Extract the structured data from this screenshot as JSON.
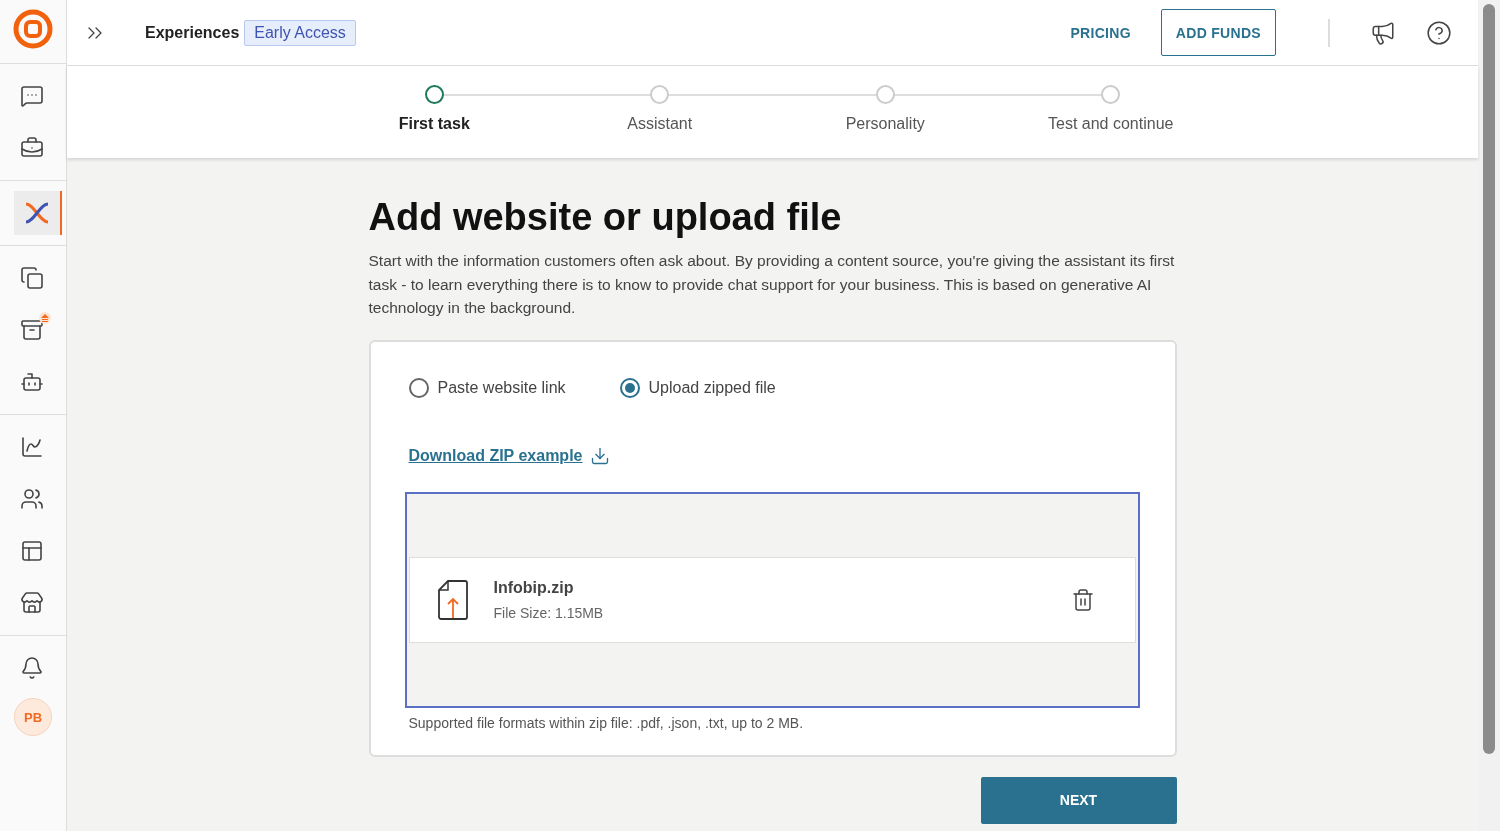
{
  "sidebar": {
    "groups": [
      [
        {
          "selected": false
        },
        {
          "selected": false
        }
      ],
      [
        {
          "selected": true
        }
      ],
      [
        {
          "selected": false,
          "badge": false
        },
        {
          "selected": false,
          "badge": true
        },
        {
          "selected": false,
          "badge": false
        }
      ],
      [
        {
          "selected": false
        },
        {
          "selected": false
        },
        {
          "selected": false
        },
        {
          "selected": false
        }
      ],
      [
        {
          "selected": false
        }
      ]
    ],
    "avatar": "PB"
  },
  "header": {
    "title": "Experiences",
    "badge": "Early Access",
    "pricing": "PRICING",
    "add_funds": "ADD FUNDS"
  },
  "steps": [
    {
      "label": "First task",
      "selected": true
    },
    {
      "label": "Assistant",
      "selected": false
    },
    {
      "label": "Personality",
      "selected": false
    },
    {
      "label": "Test and continue",
      "selected": false
    }
  ],
  "heading": "Add website or upload file",
  "description": "Start with the information customers often ask about. By providing a content source, you're giving the assistant its first task - to learn everything there is to know to provide chat support for your business. This is based on generative AI technology in the background.",
  "options": [
    {
      "label": "Paste website link",
      "selected": false
    },
    {
      "label": "Upload zipped file",
      "selected": true
    }
  ],
  "download_link": "Download ZIP example",
  "file": {
    "name": "Infobip.zip",
    "size": "File Size: 1.15MB"
  },
  "hint": "Supported file formats within zip file: .pdf, .json, .txt, up to 2 MB.",
  "next_button": "NEXT"
}
